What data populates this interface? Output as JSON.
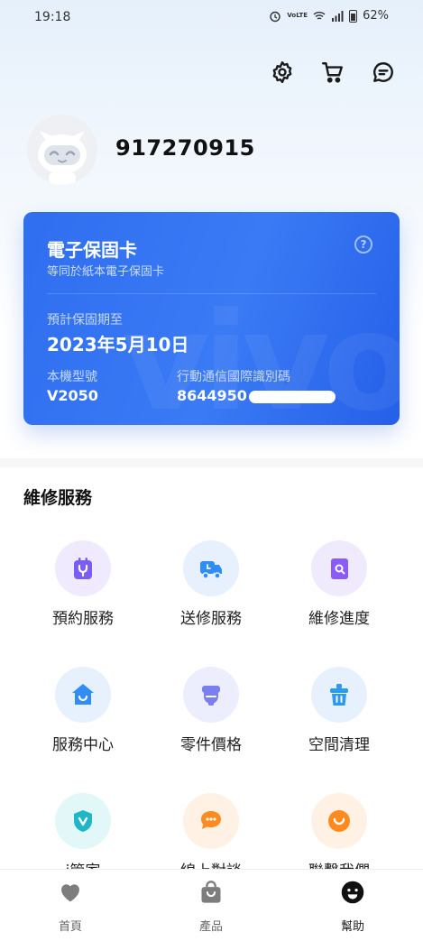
{
  "status_bar": {
    "time": "19:18",
    "network": "VoLTE",
    "battery": "62%"
  },
  "header": {
    "icons": [
      "gear-icon",
      "cart-icon",
      "message-icon"
    ]
  },
  "profile": {
    "user_id": "917270915"
  },
  "warranty_card": {
    "title": "電子保固卡",
    "subtitle": "等同於紙本電子保固卡",
    "help_symbol": "?",
    "expiry_label": "預計保固期至",
    "expiry_value": "2023年5月10日",
    "model_label": "本機型號",
    "model_value": "V2050",
    "imei_label": "行動通信國際識別碼",
    "imei_value": "8644950"
  },
  "repair_service": {
    "title": "維修服務",
    "items": [
      {
        "label": "預約服務",
        "icon": "calendar-wrench-icon",
        "color": "#7b5cf5"
      },
      {
        "label": "送修服務",
        "icon": "delivery-truck-icon",
        "color": "#2f8df5"
      },
      {
        "label": "維修進度",
        "icon": "document-search-icon",
        "color": "#8a5cf5"
      },
      {
        "label": "服務中心",
        "icon": "house-icon",
        "color": "#2f8df5"
      },
      {
        "label": "零件價格",
        "icon": "part-icon",
        "color": "#7a7ff0"
      },
      {
        "label": "空間清理",
        "icon": "trash-bin-icon",
        "color": "#2b9af0"
      },
      {
        "label": "i管家",
        "icon": "shield-icon",
        "color": "#1fb6c5"
      },
      {
        "label": "線上對談",
        "icon": "chat-bubble-icon",
        "color": "#ff8a1f"
      },
      {
        "label": "聯繫我們",
        "icon": "smile-icon",
        "color": "#ff8a1f"
      }
    ]
  },
  "bottom_nav": {
    "items": [
      {
        "label": "首頁",
        "icon": "heart-icon"
      },
      {
        "label": "產品",
        "icon": "shopping-bag-icon"
      },
      {
        "label": "幫助",
        "icon": "smiley-face-icon",
        "active": true
      }
    ]
  }
}
